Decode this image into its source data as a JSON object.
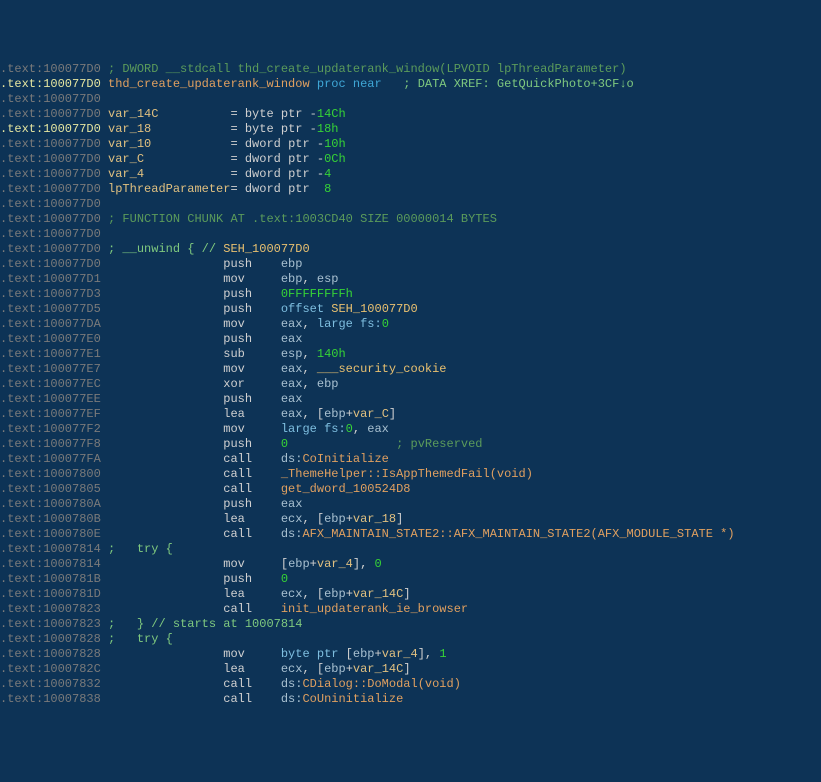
{
  "addr_prefix": ".text:",
  "lines": [
    {
      "a": "100077D0",
      "k": "cmt",
      "t": "; DWORD __stdcall thd_create_updaterank_window(LPVOID lpThreadParameter)"
    },
    {
      "a": "100077D0",
      "k": "proc",
      "name": "thd_create_updaterank_window",
      "tail": " proc near",
      "xref": "; DATA XREF: GetQuickPhoto+3CF↓o",
      "hi": true
    },
    {
      "a": "100077D0",
      "k": "blank"
    },
    {
      "a": "100077D0",
      "k": "vardecl",
      "name": "var_14C",
      "eq": "= byte ptr -",
      "off": "14Ch"
    },
    {
      "a": "100077D0",
      "k": "vardecl",
      "name": "var_18",
      "eq": "= byte ptr -",
      "off": "18h",
      "hi": true
    },
    {
      "a": "100077D0",
      "k": "vardecl",
      "name": "var_10",
      "eq": "= dword ptr -",
      "off": "10h"
    },
    {
      "a": "100077D0",
      "k": "vardecl",
      "name": "var_C",
      "eq": "= dword ptr -",
      "off": "0Ch"
    },
    {
      "a": "100077D0",
      "k": "vardecl",
      "name": "var_4",
      "eq": "= dword ptr -",
      "off": "4"
    },
    {
      "a": "100077D0",
      "k": "vardecl",
      "name": "lpThreadParameter",
      "eq": "= dword ptr  ",
      "off": "8"
    },
    {
      "a": "100077D0",
      "k": "blank"
    },
    {
      "a": "100077D0",
      "k": "cmt",
      "t": "; FUNCTION CHUNK AT .text:1003CD40 SIZE 00000014 BYTES"
    },
    {
      "a": "100077D0",
      "k": "blank"
    },
    {
      "a": "100077D0",
      "k": "unwind",
      "t": "; __unwind { //",
      "seh": "SEH_100077D0"
    },
    {
      "a": "100077D0",
      "k": "ins",
      "mn": "push",
      "op": [
        {
          "t": "reg",
          "v": "ebp"
        }
      ]
    },
    {
      "a": "100077D1",
      "k": "ins",
      "mn": "mov",
      "op": [
        {
          "t": "reg",
          "v": "ebp"
        },
        {
          "t": "txt",
          "v": ", "
        },
        {
          "t": "reg",
          "v": "esp"
        }
      ]
    },
    {
      "a": "100077D3",
      "k": "ins",
      "mn": "push",
      "op": [
        {
          "t": "num",
          "v": "0FFFFFFFFh"
        }
      ]
    },
    {
      "a": "100077D5",
      "k": "ins",
      "mn": "push",
      "op": [
        {
          "t": "kw",
          "v": "offset "
        },
        {
          "t": "label",
          "v": "SEH_100077D0"
        }
      ]
    },
    {
      "a": "100077DA",
      "k": "ins",
      "mn": "mov",
      "op": [
        {
          "t": "reg",
          "v": "eax"
        },
        {
          "t": "txt",
          "v": ", "
        },
        {
          "t": "kw",
          "v": "large fs:"
        },
        {
          "t": "num",
          "v": "0"
        }
      ]
    },
    {
      "a": "100077E0",
      "k": "ins",
      "mn": "push",
      "op": [
        {
          "t": "reg",
          "v": "eax"
        }
      ]
    },
    {
      "a": "100077E1",
      "k": "ins",
      "mn": "sub",
      "op": [
        {
          "t": "reg",
          "v": "esp"
        },
        {
          "t": "txt",
          "v": ", "
        },
        {
          "t": "num",
          "v": "140h"
        }
      ]
    },
    {
      "a": "100077E7",
      "k": "ins",
      "mn": "mov",
      "op": [
        {
          "t": "reg",
          "v": "eax"
        },
        {
          "t": "txt",
          "v": ", "
        },
        {
          "t": "label",
          "v": "___security_cookie"
        }
      ]
    },
    {
      "a": "100077EC",
      "k": "ins",
      "mn": "xor",
      "op": [
        {
          "t": "reg",
          "v": "eax"
        },
        {
          "t": "txt",
          "v": ", "
        },
        {
          "t": "reg",
          "v": "ebp"
        }
      ]
    },
    {
      "a": "100077EE",
      "k": "ins",
      "mn": "push",
      "op": [
        {
          "t": "reg",
          "v": "eax"
        }
      ]
    },
    {
      "a": "100077EF",
      "k": "ins",
      "mn": "lea",
      "op": [
        {
          "t": "reg",
          "v": "eax"
        },
        {
          "t": "txt",
          "v": ", ["
        },
        {
          "t": "reg",
          "v": "ebp"
        },
        {
          "t": "txt",
          "v": "+"
        },
        {
          "t": "var",
          "v": "var_C"
        },
        {
          "t": "txt",
          "v": "]"
        }
      ]
    },
    {
      "a": "100077F2",
      "k": "ins",
      "mn": "mov",
      "op": [
        {
          "t": "kw",
          "v": "large fs:"
        },
        {
          "t": "num",
          "v": "0"
        },
        {
          "t": "txt",
          "v": ", "
        },
        {
          "t": "reg",
          "v": "eax"
        }
      ]
    },
    {
      "a": "100077F8",
      "k": "ins",
      "mn": "push",
      "op": [
        {
          "t": "num",
          "v": "0"
        }
      ],
      "tail_cmt": "; pvReserved"
    },
    {
      "a": "100077FA",
      "k": "ins",
      "mn": "call",
      "op": [
        {
          "t": "reg",
          "v": "ds:"
        },
        {
          "t": "func",
          "v": "CoInitialize"
        }
      ]
    },
    {
      "a": "10007800",
      "k": "ins",
      "mn": "call",
      "op": [
        {
          "t": "func",
          "v": "_ThemeHelper::IsAppThemedFail(void)"
        }
      ]
    },
    {
      "a": "10007805",
      "k": "ins",
      "mn": "call",
      "op": [
        {
          "t": "func",
          "v": "get_dword_100524D8"
        }
      ]
    },
    {
      "a": "1000780A",
      "k": "ins",
      "mn": "push",
      "op": [
        {
          "t": "reg",
          "v": "eax"
        }
      ]
    },
    {
      "a": "1000780B",
      "k": "ins",
      "mn": "lea",
      "op": [
        {
          "t": "reg",
          "v": "ecx"
        },
        {
          "t": "txt",
          "v": ", ["
        },
        {
          "t": "reg",
          "v": "ebp"
        },
        {
          "t": "txt",
          "v": "+"
        },
        {
          "t": "var",
          "v": "var_18"
        },
        {
          "t": "txt",
          "v": "]"
        }
      ]
    },
    {
      "a": "1000780E",
      "k": "ins",
      "mn": "call",
      "op": [
        {
          "t": "reg",
          "v": "ds:"
        },
        {
          "t": "func",
          "v": "AFX_MAINTAIN_STATE2::AFX_MAINTAIN_STATE2(AFX_MODULE_STATE *)"
        }
      ]
    },
    {
      "a": "10007814",
      "k": "try",
      "t": ";   try {"
    },
    {
      "a": "10007814",
      "k": "ins",
      "mn": "mov",
      "op": [
        {
          "t": "txt",
          "v": "["
        },
        {
          "t": "reg",
          "v": "ebp"
        },
        {
          "t": "txt",
          "v": "+"
        },
        {
          "t": "var",
          "v": "var_4"
        },
        {
          "t": "txt",
          "v": "], "
        },
        {
          "t": "num",
          "v": "0"
        }
      ]
    },
    {
      "a": "1000781B",
      "k": "ins",
      "mn": "push",
      "op": [
        {
          "t": "num",
          "v": "0"
        }
      ]
    },
    {
      "a": "1000781D",
      "k": "ins",
      "mn": "lea",
      "op": [
        {
          "t": "reg",
          "v": "ecx"
        },
        {
          "t": "txt",
          "v": ", ["
        },
        {
          "t": "reg",
          "v": "ebp"
        },
        {
          "t": "txt",
          "v": "+"
        },
        {
          "t": "var",
          "v": "var_14C"
        },
        {
          "t": "txt",
          "v": "]"
        }
      ]
    },
    {
      "a": "10007823",
      "k": "ins",
      "mn": "call",
      "op": [
        {
          "t": "func",
          "v": "init_updaterank_ie_browser"
        }
      ]
    },
    {
      "a": "10007823",
      "k": "try",
      "t": ";   } // starts at 10007814"
    },
    {
      "a": "10007828",
      "k": "try",
      "t": ";   try {"
    },
    {
      "a": "10007828",
      "k": "ins",
      "mn": "mov",
      "op": [
        {
          "t": "kw",
          "v": "byte ptr "
        },
        {
          "t": "txt",
          "v": "["
        },
        {
          "t": "reg",
          "v": "ebp"
        },
        {
          "t": "txt",
          "v": "+"
        },
        {
          "t": "var",
          "v": "var_4"
        },
        {
          "t": "txt",
          "v": "], "
        },
        {
          "t": "num",
          "v": "1"
        }
      ]
    },
    {
      "a": "1000782C",
      "k": "ins",
      "mn": "lea",
      "op": [
        {
          "t": "reg",
          "v": "ecx"
        },
        {
          "t": "txt",
          "v": ", ["
        },
        {
          "t": "reg",
          "v": "ebp"
        },
        {
          "t": "txt",
          "v": "+"
        },
        {
          "t": "var",
          "v": "var_14C"
        },
        {
          "t": "txt",
          "v": "]"
        }
      ]
    },
    {
      "a": "10007832",
      "k": "ins",
      "mn": "call",
      "op": [
        {
          "t": "reg",
          "v": "ds:"
        },
        {
          "t": "func",
          "v": "CDialog::DoModal(void)"
        }
      ]
    },
    {
      "a": "10007838",
      "k": "ins",
      "mn": "call",
      "op": [
        {
          "t": "reg",
          "v": "ds:"
        },
        {
          "t": "func",
          "v": "CoUninitialize"
        }
      ]
    }
  ]
}
